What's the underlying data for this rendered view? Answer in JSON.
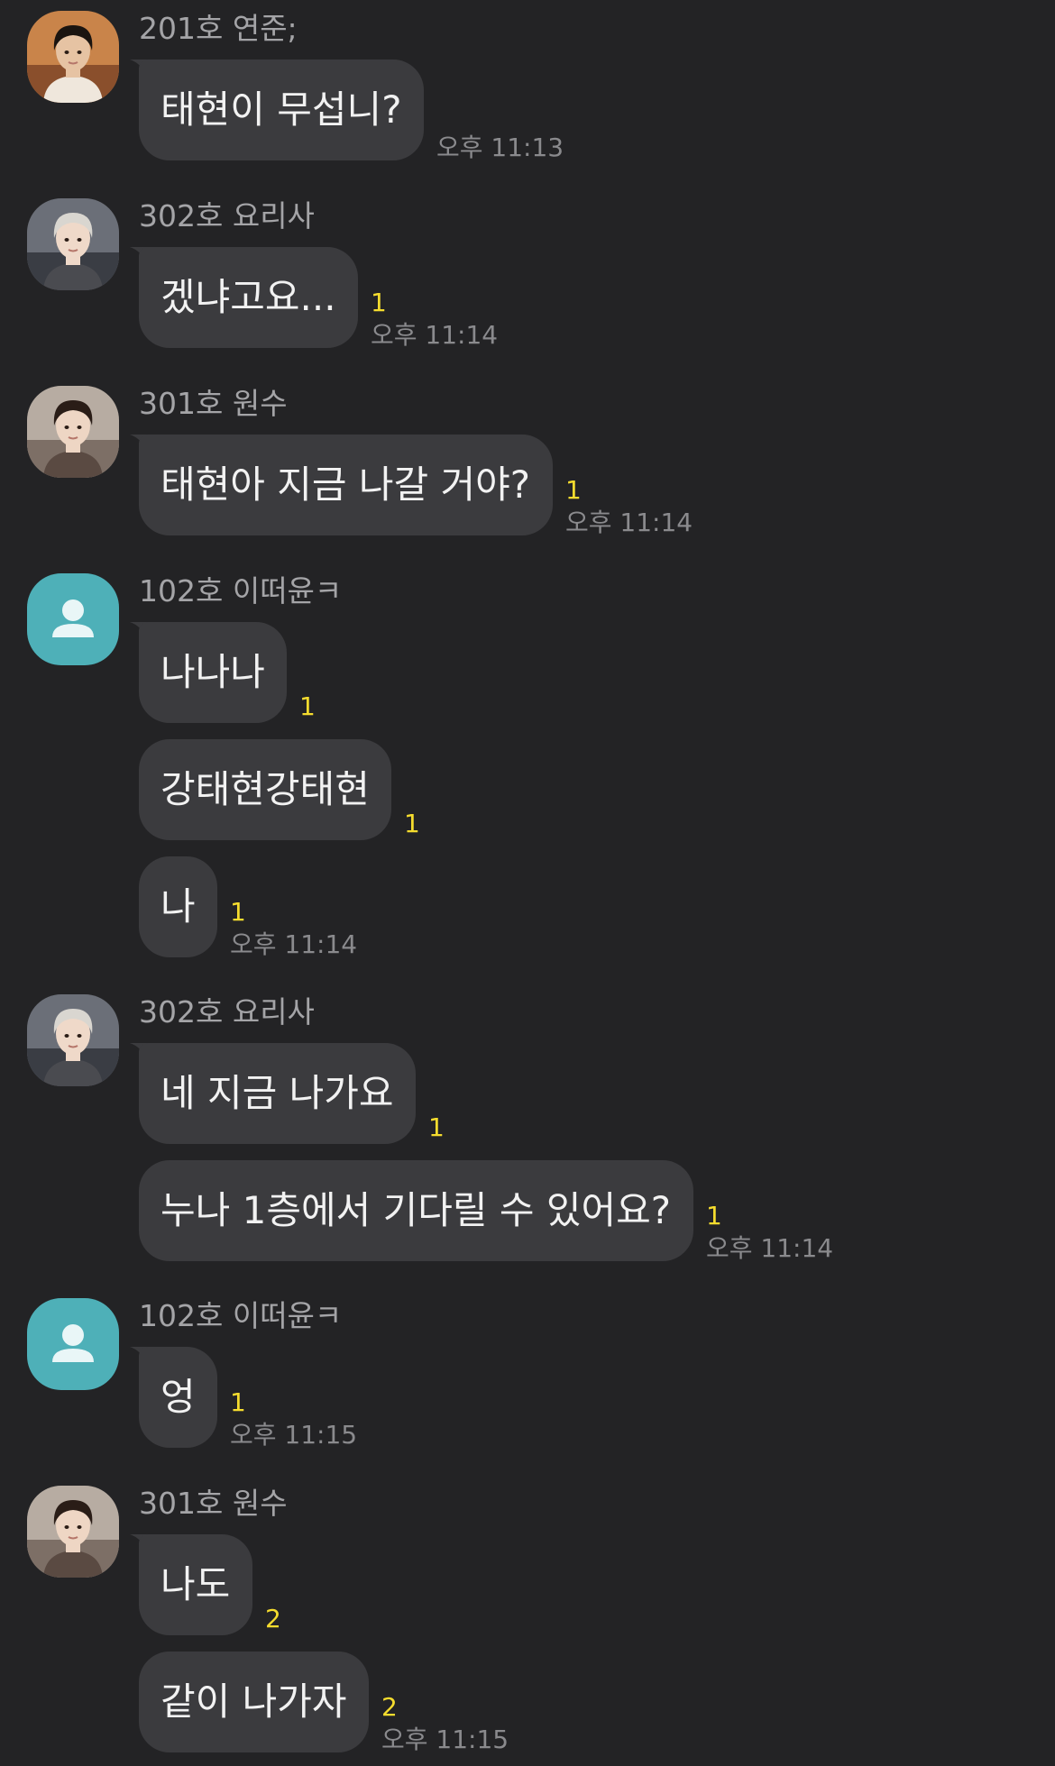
{
  "unread_color": "#f5dc2e",
  "bubble_color": "#3b3b3e",
  "groups": [
    {
      "sender": "201호 연준;",
      "avatar_icon": "photo-avatar",
      "messages": [
        {
          "text": "태현이 무섭니?",
          "unread": "",
          "time": "오후 11:13"
        }
      ]
    },
    {
      "sender": "302호 요리사",
      "avatar_icon": "photo-avatar",
      "messages": [
        {
          "text": "겠냐고요...",
          "unread": "1",
          "time": "오후 11:14"
        }
      ]
    },
    {
      "sender": "301호 원수",
      "avatar_icon": "photo-avatar",
      "messages": [
        {
          "text": "태현아 지금 나갈 거야?",
          "unread": "1",
          "time": "오후 11:14"
        }
      ]
    },
    {
      "sender": "102호 이떠윤ㅋ",
      "avatar_icon": "default-profile-icon",
      "messages": [
        {
          "text": "나나나",
          "unread": "1",
          "time": ""
        },
        {
          "text": "강태현강태현",
          "unread": "1",
          "time": ""
        },
        {
          "text": "나",
          "unread": "1",
          "time": "오후 11:14"
        }
      ]
    },
    {
      "sender": "302호 요리사",
      "avatar_icon": "photo-avatar",
      "messages": [
        {
          "text": "네 지금 나가요",
          "unread": "1",
          "time": ""
        },
        {
          "text": "누나 1층에서 기다릴 수 있어요?",
          "unread": "1",
          "time": "오후 11:14"
        }
      ]
    },
    {
      "sender": "102호 이떠윤ㅋ",
      "avatar_icon": "default-profile-icon",
      "messages": [
        {
          "text": "엉",
          "unread": "1",
          "time": "오후 11:15"
        }
      ]
    },
    {
      "sender": "301호 원수",
      "avatar_icon": "photo-avatar",
      "messages": [
        {
          "text": "나도",
          "unread": "2",
          "time": ""
        },
        {
          "text": "같이 나가자",
          "unread": "2",
          "time": "오후 11:15"
        }
      ]
    }
  ]
}
